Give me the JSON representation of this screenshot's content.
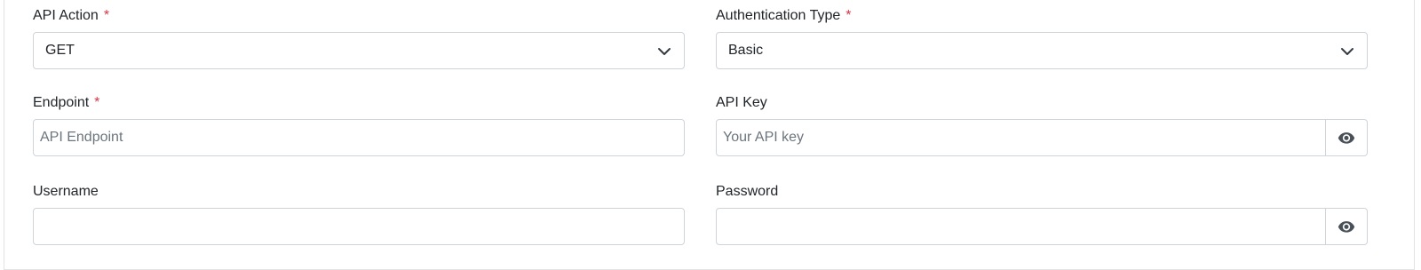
{
  "form": {
    "required_marker": "*",
    "api_action": {
      "label": "API Action",
      "value": "GET"
    },
    "auth_type": {
      "label": "Authentication Type",
      "value": "Basic"
    },
    "endpoint": {
      "label": "Endpoint",
      "placeholder": "API Endpoint",
      "value": ""
    },
    "api_key": {
      "label": "API Key",
      "placeholder": "Your API key",
      "value": ""
    },
    "username": {
      "label": "Username",
      "value": ""
    },
    "password": {
      "label": "Password",
      "value": ""
    }
  },
  "icons": {
    "select_caret": "chevron-down-icon",
    "visibility_toggle": "eye-icon"
  },
  "colors": {
    "required": "#dc3545",
    "border": "#ced4da",
    "placeholder": "#6c757d",
    "text": "#212529"
  }
}
